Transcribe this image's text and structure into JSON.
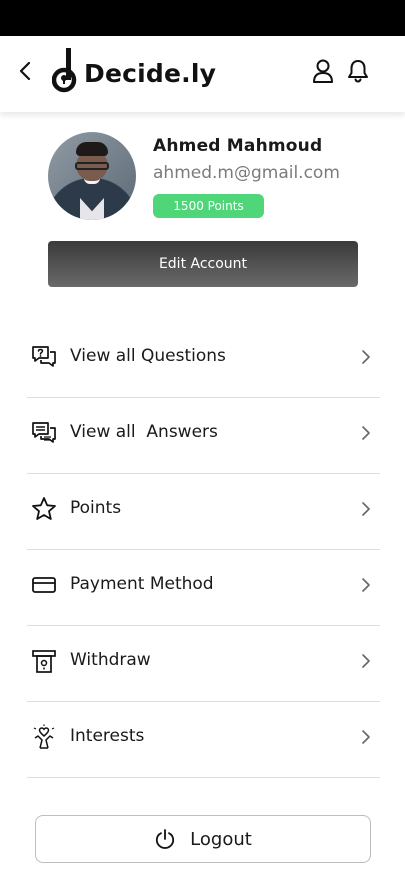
{
  "app": {
    "brand": "Decide.ly"
  },
  "header": {
    "back_icon": "chevron-left-icon",
    "user_icon": "user-icon",
    "bell_icon": "bell-icon"
  },
  "profile": {
    "name": "Ahmed Mahmoud",
    "email": "ahmed.m@gmail.com",
    "points": "1500 Points",
    "points_color": "#4fd679"
  },
  "actions": {
    "edit_account": "Edit Account",
    "logout": "Logout"
  },
  "menu": {
    "items": [
      {
        "label": "View all Questions",
        "icon": "question-chat-icon"
      },
      {
        "label": "View all  Answers",
        "icon": "answer-chat-icon"
      },
      {
        "label": "Points",
        "icon": "star-icon"
      },
      {
        "label": "Payment Method",
        "icon": "card-icon"
      },
      {
        "label": "Withdraw",
        "icon": "atm-withdraw-icon"
      },
      {
        "label": "Interests",
        "icon": "heart-hand-icon"
      }
    ]
  }
}
